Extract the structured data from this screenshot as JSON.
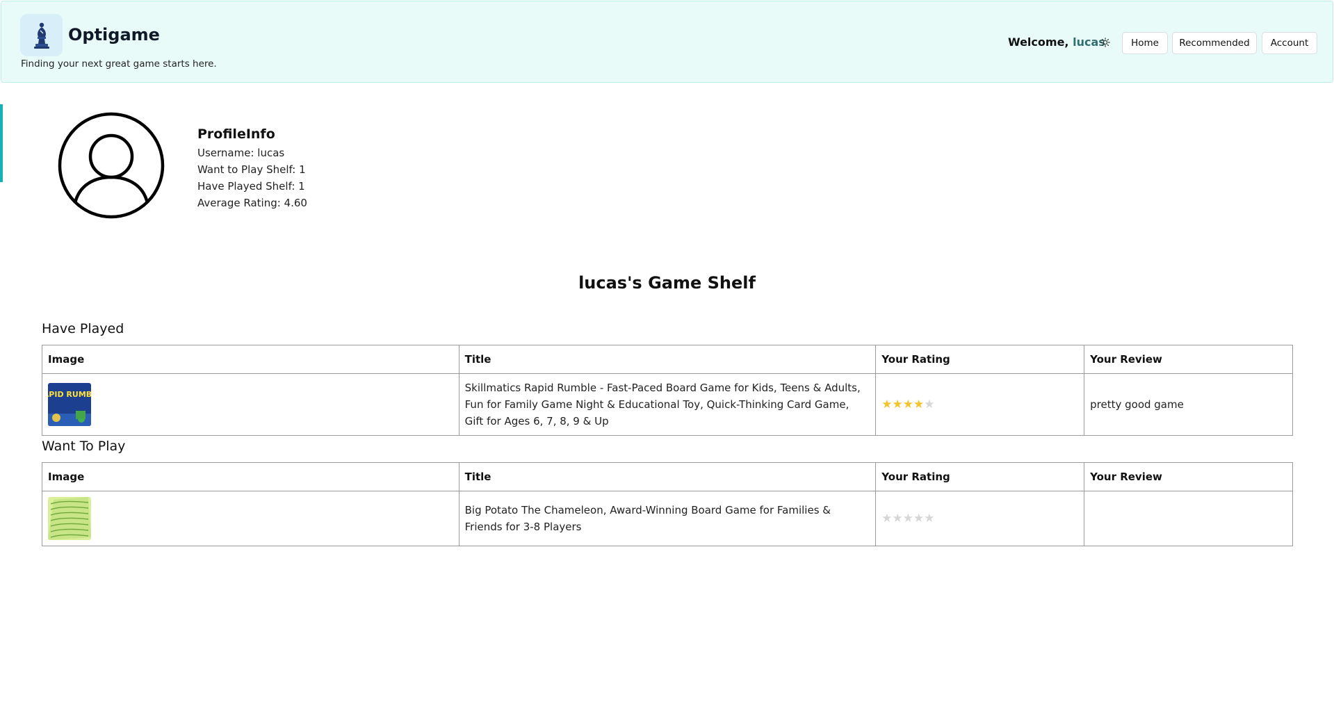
{
  "header": {
    "brand": "Optigame",
    "tagline": "Finding your next great game starts here.",
    "welcome_prefix": "Welcome,",
    "username": "lucas",
    "theme_icon": "sun-icon",
    "nav": {
      "home": "Home",
      "recommended": "Recommended",
      "account": "Account"
    }
  },
  "profile": {
    "title": "ProfileInfo",
    "username_line": "Username: lucas",
    "want_line": "Want to Play Shelf: 1",
    "played_line": "Have Played Shelf: 1",
    "rating_line": "Average Rating: 4.60"
  },
  "shelf": {
    "title": "lucas's Game Shelf",
    "columns": {
      "image": "Image",
      "title": "Title",
      "rating": "Your Rating",
      "review": "Your Review"
    },
    "have_played": {
      "heading": "Have Played",
      "rows": [
        {
          "title": "Skillmatics Rapid Rumble - Fast-Paced Board Game for Kids, Teens & Adults, Fun for Family Game Night & Educational Toy, Quick-Thinking Card Game, Gift for Ages 6, 7, 8, 9 & Up",
          "rating": 4,
          "review": "pretty good game",
          "thumb_label": "RAPID RUMBLE"
        }
      ]
    },
    "want_to_play": {
      "heading": "Want To Play",
      "rows": [
        {
          "title": "Big Potato The Chameleon, Award-Winning Board Game for Families & Friends for 3-8 Players",
          "rating": 0,
          "review": ""
        }
      ]
    }
  },
  "colors": {
    "header_bg": "#e9fbf8",
    "username": "#2f6f6f",
    "star_on": "#f5c22b",
    "star_off": "#d6d6d6",
    "accent_bar": "#19b0b4"
  }
}
